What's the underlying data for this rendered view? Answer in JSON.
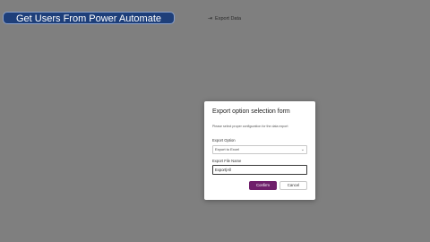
{
  "header": {
    "banner_title": "Get Users From Power Automate",
    "export_label": "Export Data",
    "export_icon": "export-icon"
  },
  "dialog": {
    "title": "Export option selection form",
    "description": "Please select proper configuration for the data export",
    "option_label": "Export Option",
    "option_value": "Export to Excel",
    "filename_label": "Export File Name",
    "filename_value": "Export|All",
    "confirm_label": "Confirm",
    "cancel_label": "Cancel"
  },
  "colors": {
    "backdrop": "#7f7f7f",
    "banner": "#1e3f7a",
    "confirm": "#6f1f6b"
  }
}
